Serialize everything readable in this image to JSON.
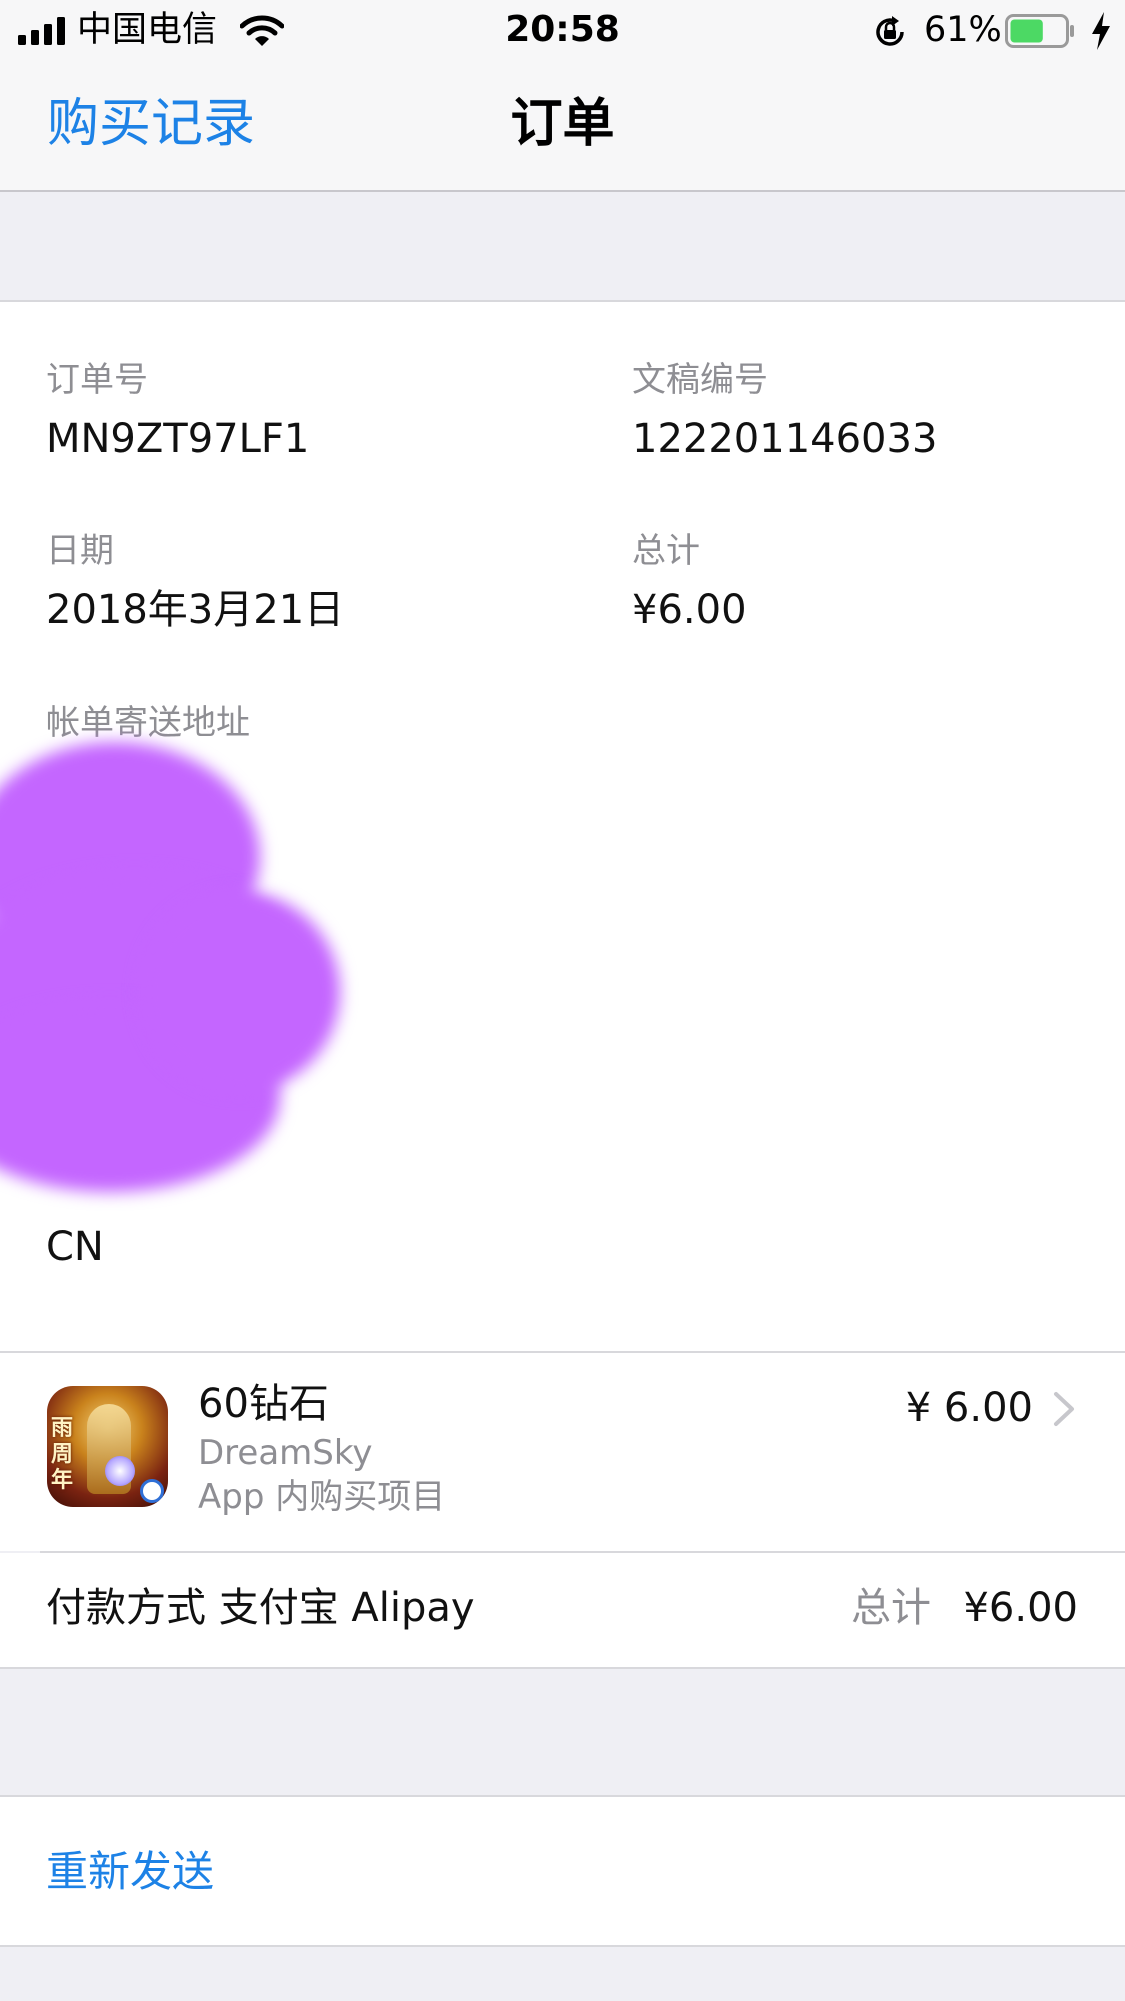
{
  "status_bar": {
    "carrier": "中国电信",
    "time": "20:58",
    "battery_percent": "61%",
    "battery_level": 0.61,
    "battery_color": "#4cd964",
    "icons": [
      "signal-bars-icon",
      "wifi-icon",
      "orientation-lock-icon",
      "battery-icon",
      "charging-bolt-icon"
    ]
  },
  "nav": {
    "back_label": "购买记录",
    "title": "订单",
    "accent_color": "#1d82e6"
  },
  "order": {
    "order_id": {
      "label": "订单号",
      "value": "MN9ZT97LF1"
    },
    "document_no": {
      "label": "文稿编号",
      "value": "122201146033"
    },
    "date": {
      "label": "日期",
      "value": "2018年3月21日"
    },
    "total": {
      "label": "总计",
      "value": "¥6.00"
    },
    "billing_address": {
      "label": "帐单寄送地址",
      "country": "CN",
      "redaction_color": "#c466ff"
    }
  },
  "item": {
    "name": "60钻石",
    "developer": "DreamSky",
    "type": "App 内购买项目",
    "price": "¥ 6.00",
    "icon_text": "雨周年"
  },
  "payment": {
    "method": "付款方式 支付宝 Alipay",
    "total_label": "总计",
    "total_value": "¥6.00"
  },
  "actions": {
    "resend_label": "重新发送"
  }
}
